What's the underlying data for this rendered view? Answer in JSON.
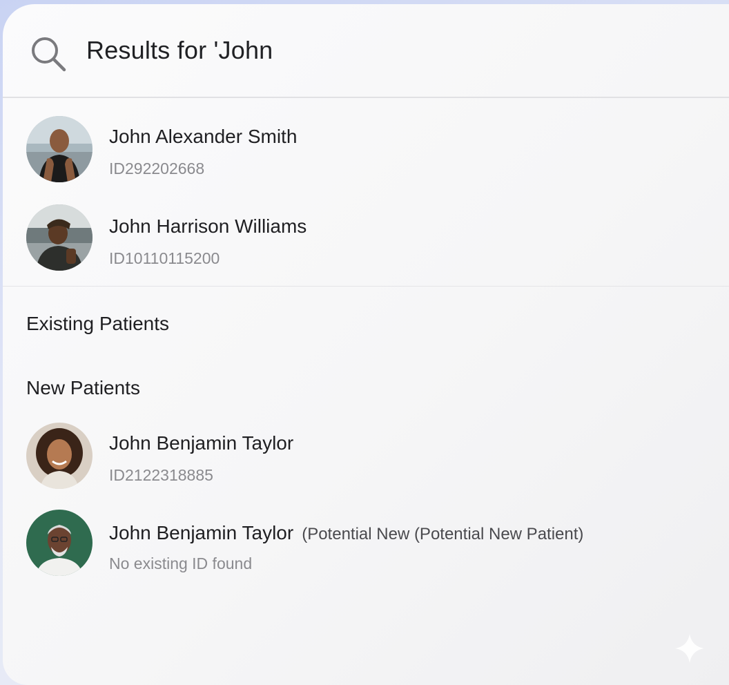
{
  "search": {
    "title": "Results for 'John",
    "icon": "search-icon"
  },
  "top_results": [
    {
      "name": "John Alexander Smith",
      "id": "ID292202668"
    },
    {
      "name": "John Harrison Williams",
      "id": "ID10110115200"
    }
  ],
  "sections": {
    "existing_label": "Existing Patients",
    "new_label": "New Patients"
  },
  "new_patients": [
    {
      "name": "John Benjamin Taylor",
      "id": "ID2122318885"
    },
    {
      "name": "John Benjamin Taylor",
      "tag": "(Potential New (Potential New Patient)",
      "id": "No existing ID found"
    }
  ],
  "colors": {
    "text_primary": "#1f1f22",
    "text_secondary": "#8a8a8e",
    "divider": "#e1e1e4"
  }
}
